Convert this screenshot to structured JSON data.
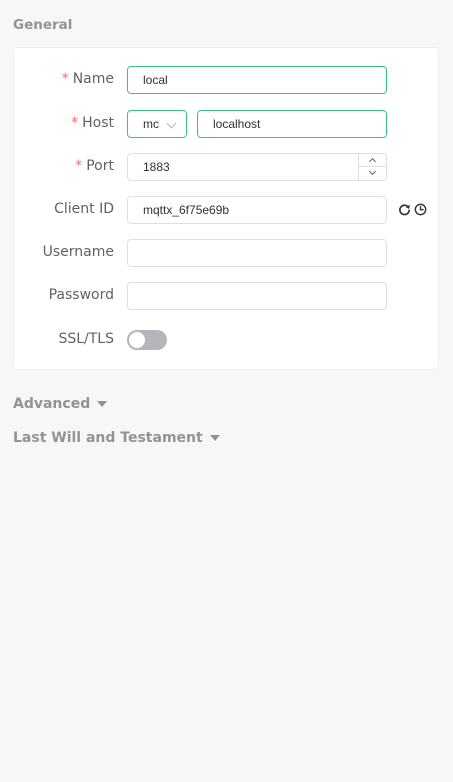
{
  "sections": {
    "general": "General",
    "advanced": "Advanced",
    "last_will": "Last Will and Testament"
  },
  "form": {
    "name": {
      "label": "Name",
      "required_mark": "*",
      "value": "local"
    },
    "host": {
      "label": "Host",
      "required_mark": "*",
      "protocol": "mqtt://",
      "protocol_visible": "mc",
      "value": "localhost"
    },
    "port": {
      "label": "Port",
      "required_mark": "*",
      "value": "1883"
    },
    "client_id": {
      "label": "Client ID",
      "value": "mqttx_6f75e69b"
    },
    "username": {
      "label": "Username",
      "value": ""
    },
    "password": {
      "label": "Password",
      "value": ""
    },
    "ssl": {
      "label": "SSL/TLS",
      "enabled": false
    }
  },
  "colors": {
    "accent": "#34c388",
    "required": "#f56c6c",
    "muted": "#909399"
  },
  "icons": {
    "refresh": "refresh-icon",
    "clock": "clock-icon",
    "select_chevron": "chevron-down-icon",
    "collapse": "caret-down-icon"
  }
}
